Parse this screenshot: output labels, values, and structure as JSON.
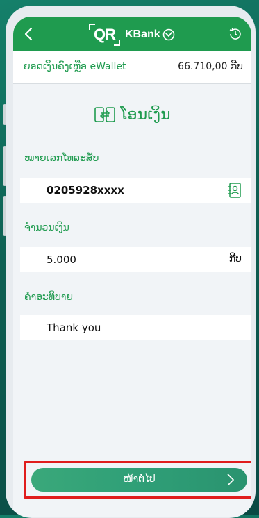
{
  "header": {
    "logo_qr": "QR",
    "logo_bank": "KBank"
  },
  "balance": {
    "label": "ຍອດເງິນຄົງເຫຼືອ eWallet",
    "value": "66.710,00 ກີບ"
  },
  "page_title": "ໂອນເງິນ",
  "form": {
    "phone_label": "ໝາຍເລກໂທລະສັບ",
    "phone_value": "0205928xxxx",
    "amount_label": "ຈຳນວນເງິນ",
    "amount_value": "5.000",
    "amount_unit": "ກີບ",
    "note_label": "ຄຳອະທິບາຍ",
    "note_value": "Thank you"
  },
  "next_button": {
    "label": "ໜ້າຕໍ່ໄປ"
  },
  "colors": {
    "brand_green": "#1f9b4f",
    "highlight_red": "#e01d1d"
  }
}
